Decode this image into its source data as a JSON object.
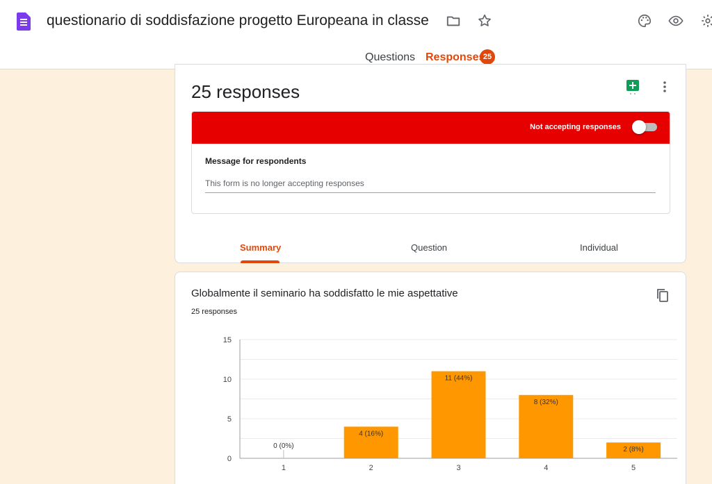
{
  "header": {
    "form_title": "questionario di soddisfazione  progetto Europeana in classe",
    "icons": [
      "forms-app-icon",
      "folder-icon",
      "star-icon",
      "palette-icon",
      "eye-icon",
      "gear-icon"
    ]
  },
  "tabs": {
    "questions": "Questions",
    "responses": "Responses",
    "responses_badge": "25"
  },
  "summary_card": {
    "title": "25 responses",
    "status": "Not accepting responses",
    "accepting": false,
    "message_label": "Message for respondents",
    "message_value": "This form is no longer accepting responses",
    "view_tabs": [
      "Summary",
      "Question",
      "Individual"
    ],
    "active_view": "Summary"
  },
  "question_card": {
    "title": "Globalmente il seminario ha soddisfatto le mie aspettative",
    "responses": "25 responses"
  },
  "colors": {
    "accent": "#e0480b",
    "banner_red": "#e60000",
    "bar": "#ff9800",
    "background": "#fdf0dd"
  },
  "chart_data": {
    "type": "bar",
    "categories": [
      "1",
      "2",
      "3",
      "4",
      "5"
    ],
    "values": [
      0,
      4,
      11,
      8,
      2
    ],
    "labels": [
      "0 (0%)",
      "4 (16%)",
      "11 (44%)",
      "8 (32%)",
      "2 (8%)"
    ],
    "yticks": [
      "0",
      "5",
      "10",
      "15"
    ],
    "ylim": [
      0,
      15
    ],
    "grid": true
  }
}
